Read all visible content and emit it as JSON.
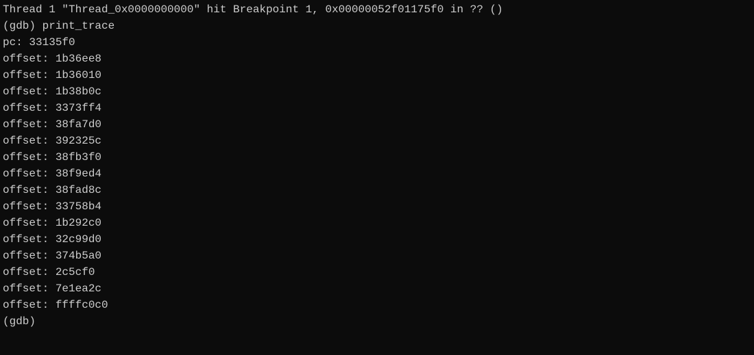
{
  "breakpoint_line": "Thread 1 \"Thread_0x0000000000\" hit Breakpoint 1, 0x00000052f01175f0 in ?? ()",
  "gdb_command_line": "(gdb) print_trace",
  "pc_line": "pc: 33135f0",
  "offsets": [
    "offset: 1b36ee8",
    "offset: 1b36010",
    "offset: 1b38b0c",
    "offset: 3373ff4",
    "offset: 38fa7d0",
    "offset: 392325c",
    "offset: 38fb3f0",
    "offset: 38f9ed4",
    "offset: 38fad8c",
    "offset: 33758b4",
    "offset: 1b292c0",
    "offset: 32c99d0",
    "offset: 374b5a0",
    "offset: 2c5cf0",
    "offset: 7e1ea2c",
    "offset: ffffc0c0"
  ],
  "gdb_prompt": "(gdb) "
}
